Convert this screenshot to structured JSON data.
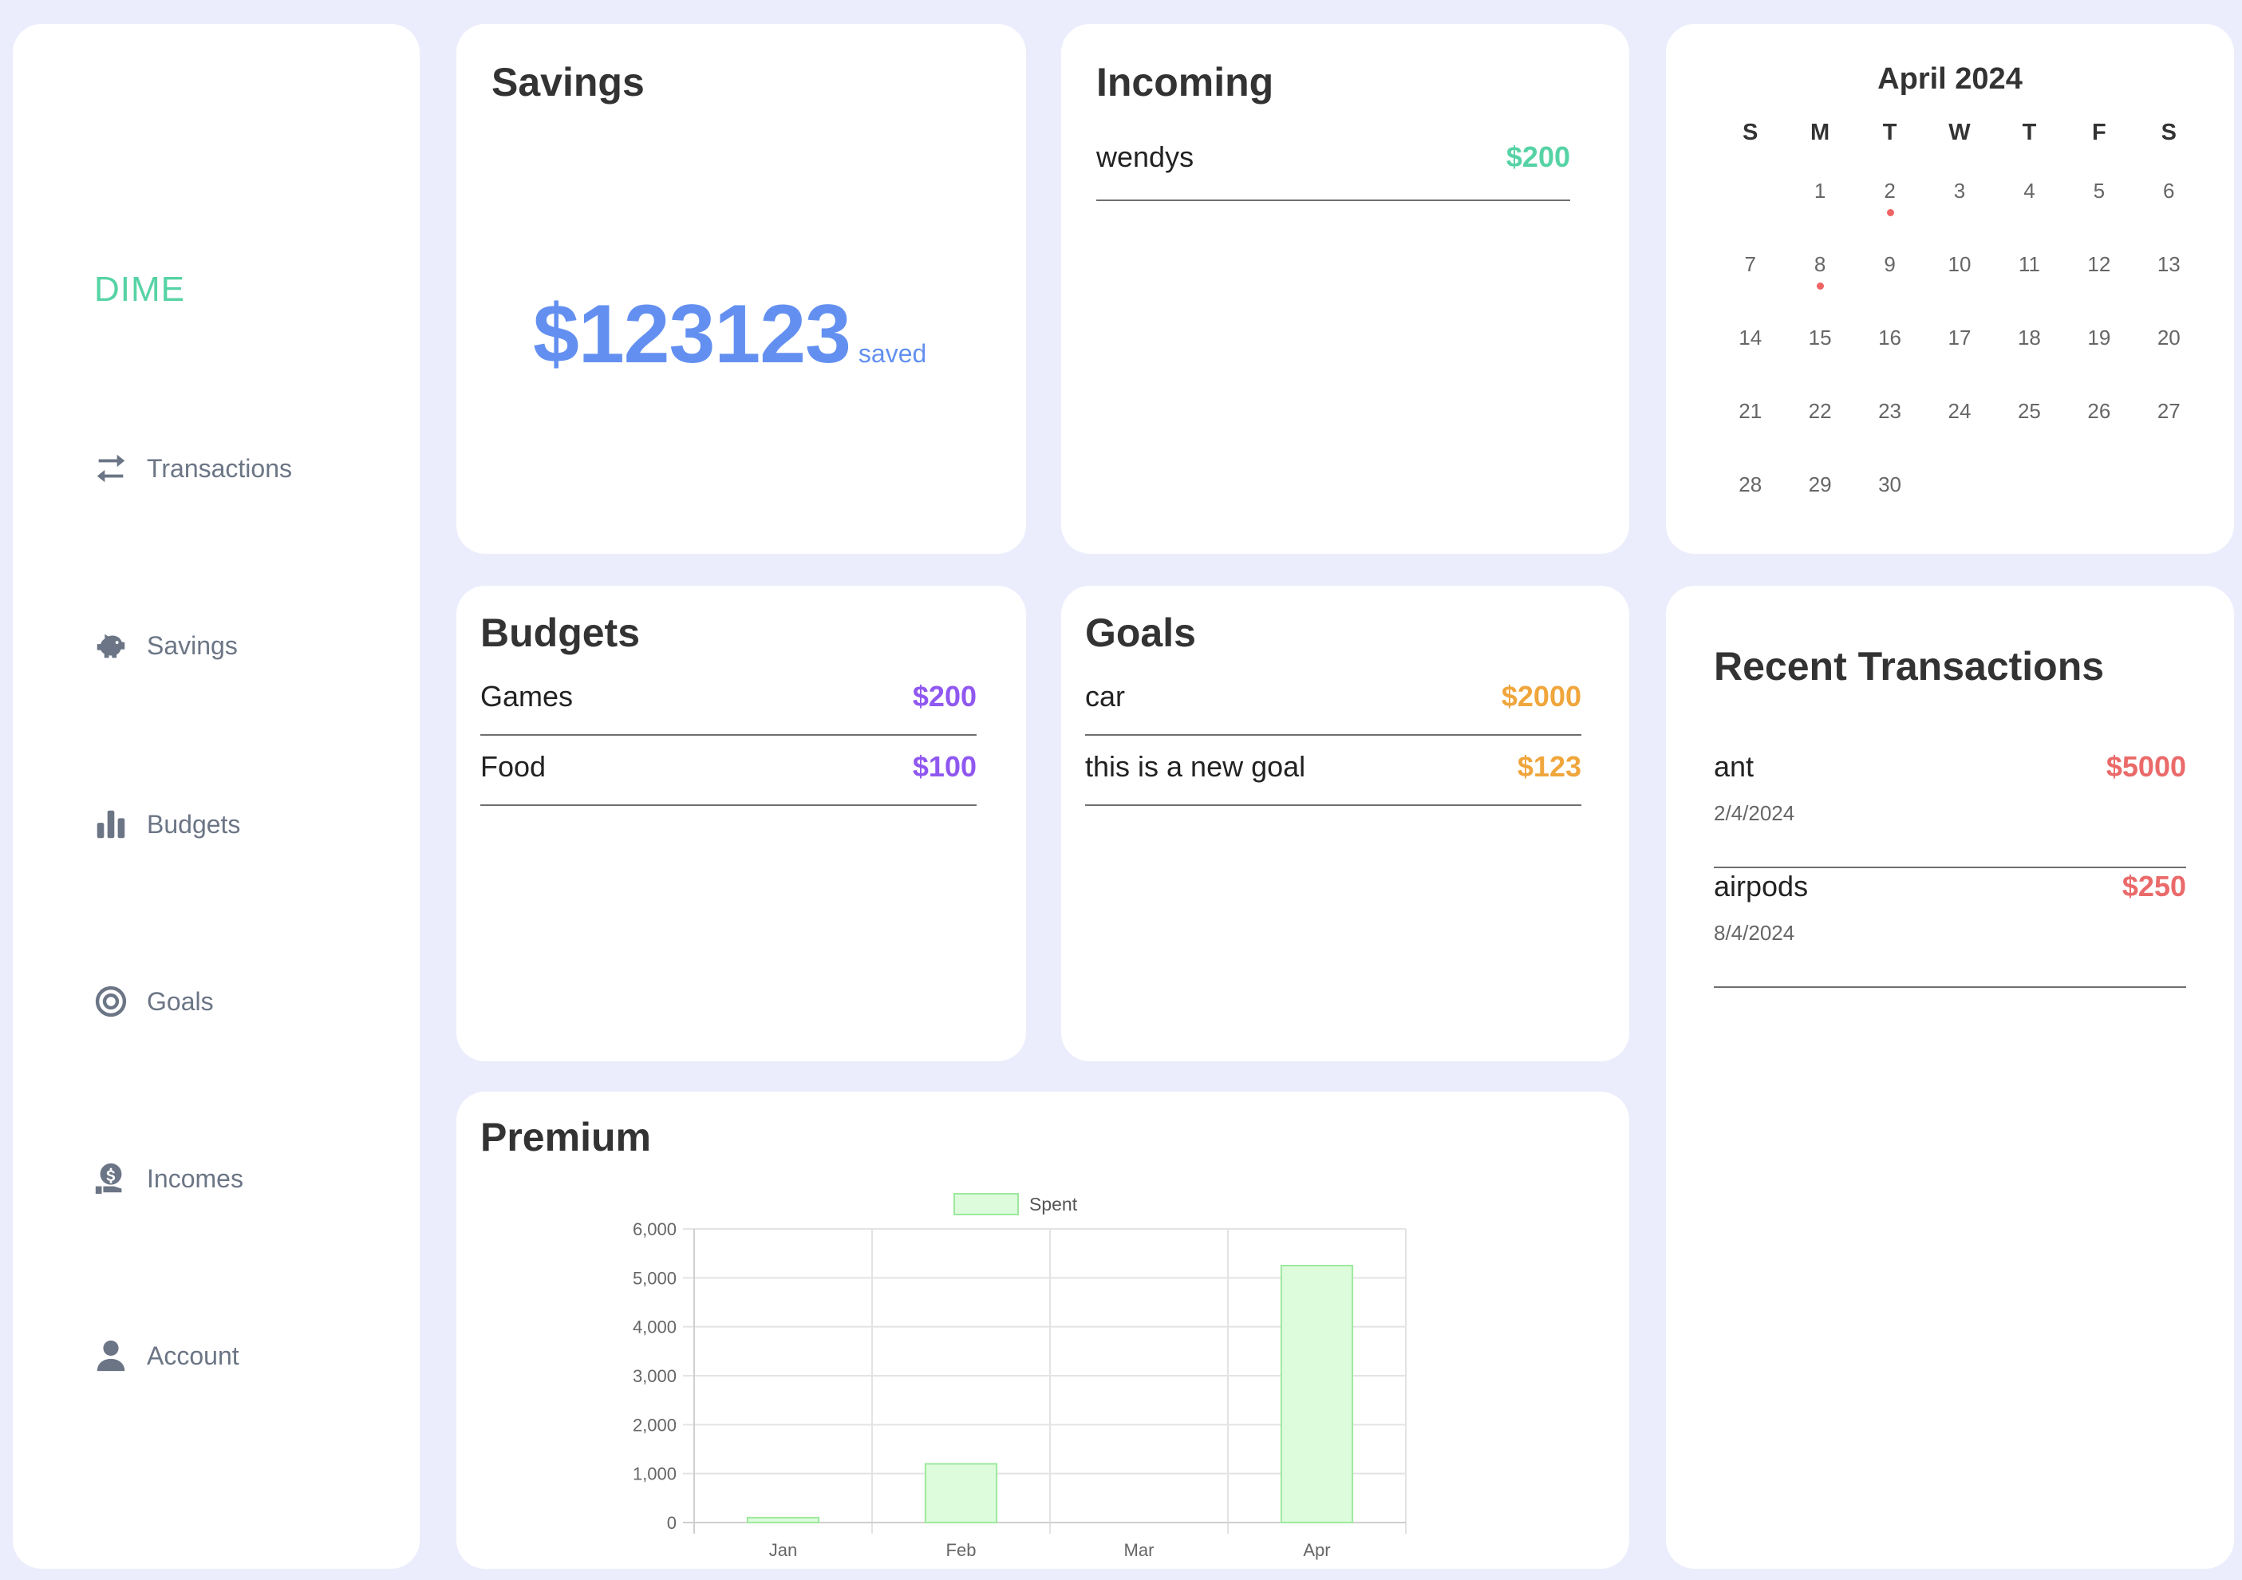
{
  "sidebar": {
    "brand": "DIME",
    "items": [
      {
        "label": "Transactions",
        "icon": "transfer-icon"
      },
      {
        "label": "Savings",
        "icon": "piggy-bank-icon"
      },
      {
        "label": "Budgets",
        "icon": "bar-chart-icon"
      },
      {
        "label": "Goals",
        "icon": "target-icon"
      },
      {
        "label": "Incomes",
        "icon": "money-hand-icon"
      },
      {
        "label": "Account",
        "icon": "user-icon"
      }
    ]
  },
  "savings": {
    "title": "Savings",
    "amount": "$123123",
    "suffix": "saved"
  },
  "incoming": {
    "title": "Incoming",
    "items": [
      {
        "label": "wendys",
        "amount": "$200"
      }
    ]
  },
  "calendar": {
    "title": "April 2024",
    "weekdays": [
      "S",
      "M",
      "T",
      "W",
      "T",
      "F",
      "S"
    ],
    "days": [
      "",
      "1",
      "2",
      "3",
      "4",
      "5",
      "6",
      "7",
      "8",
      "9",
      "10",
      "11",
      "12",
      "13",
      "14",
      "15",
      "16",
      "17",
      "18",
      "19",
      "20",
      "21",
      "22",
      "23",
      "24",
      "25",
      "26",
      "27",
      "28",
      "29",
      "30"
    ],
    "marked_days": [
      "2",
      "8"
    ]
  },
  "budgets": {
    "title": "Budgets",
    "items": [
      {
        "label": "Games",
        "amount": "$200"
      },
      {
        "label": "Food",
        "amount": "$100"
      }
    ]
  },
  "goals": {
    "title": "Goals",
    "items": [
      {
        "label": "car",
        "amount": "$2000"
      },
      {
        "label": "this is a new goal",
        "amount": "$123"
      }
    ]
  },
  "recent": {
    "title": "Recent Transactions",
    "items": [
      {
        "name": "ant",
        "amount": "$5000",
        "date": "2/4/2024"
      },
      {
        "name": "airpods",
        "amount": "$250",
        "date": "8/4/2024"
      }
    ]
  },
  "premium": {
    "title": "Premium"
  },
  "colors": {
    "brand": "#56d3a5",
    "income": "#56d3a5",
    "budget": "#9058f0",
    "goal": "#f0a63c",
    "expense": "#ea6a6a",
    "savings": "#6390f0",
    "bar_fill": "#dcfcdc",
    "bar_stroke": "#9ee89e"
  },
  "chart_data": {
    "type": "bar",
    "categories": [
      "Jan",
      "Feb",
      "Mar",
      "Apr"
    ],
    "series": [
      {
        "name": "Spent",
        "values": [
          100,
          1200,
          0,
          5250
        ]
      }
    ],
    "yticks": [
      "0",
      "1,000",
      "2,000",
      "3,000",
      "4,000",
      "5,000",
      "6,000"
    ],
    "ylim": [
      0,
      6000
    ],
    "legend": "top",
    "grid": true
  }
}
